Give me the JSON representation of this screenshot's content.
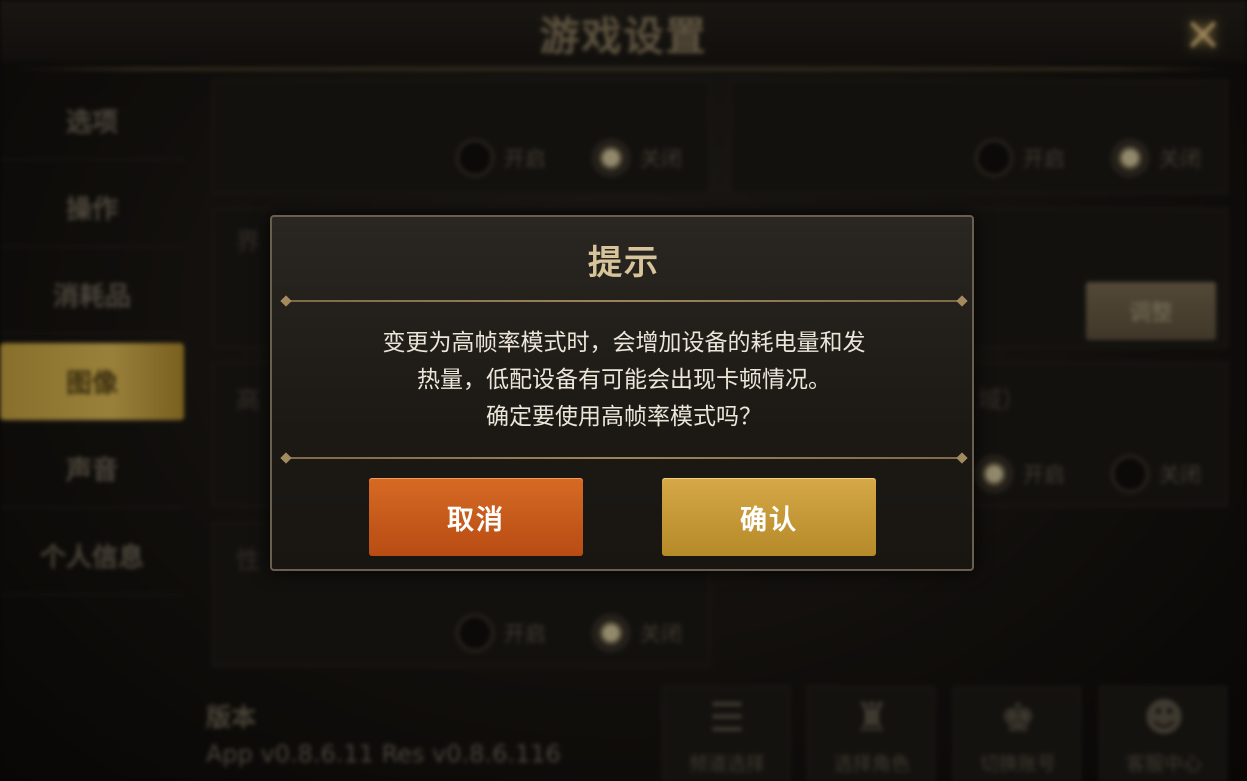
{
  "screen": {
    "title": "游戏设置",
    "close_icon": "×"
  },
  "sidebar": {
    "items": [
      {
        "label": "选项"
      },
      {
        "label": "操作"
      },
      {
        "label": "消耗品"
      },
      {
        "label": "图像",
        "active": true
      },
      {
        "label": "声音"
      },
      {
        "label": "个人信息"
      }
    ]
  },
  "settings": {
    "on_label": "开启",
    "off_label": "关闭",
    "adjust_button": "调整",
    "partial_labels": {
      "left_row2": "界",
      "left_row3": "高",
      "left_row4": "性",
      "right_row3": "域）"
    }
  },
  "version": {
    "label": "版本",
    "value": "App v0.8.6.11 Res v0.8.6.116"
  },
  "bottom_buttons": [
    {
      "label": "频道选择",
      "icon": "list-icon"
    },
    {
      "label": "选择角色",
      "icon": "character-icon"
    },
    {
      "label": "切换账号",
      "icon": "account-icon"
    },
    {
      "label": "客服中心",
      "icon": "support-icon"
    }
  ],
  "dialog": {
    "title": "提示",
    "message_lines": [
      "变更为高帧率模式时，会增加设备的耗电量和发",
      "热量，低配设备有可能会出现卡顿情况。",
      "确定要使用高帧率模式吗？"
    ],
    "cancel_label": "取消",
    "confirm_label": "确认"
  },
  "colors": {
    "cancel_button": "#c85a1b",
    "confirm_button": "#c99a36",
    "active_tab": "#d7b24e",
    "dialog_title": "#d8c49a"
  }
}
